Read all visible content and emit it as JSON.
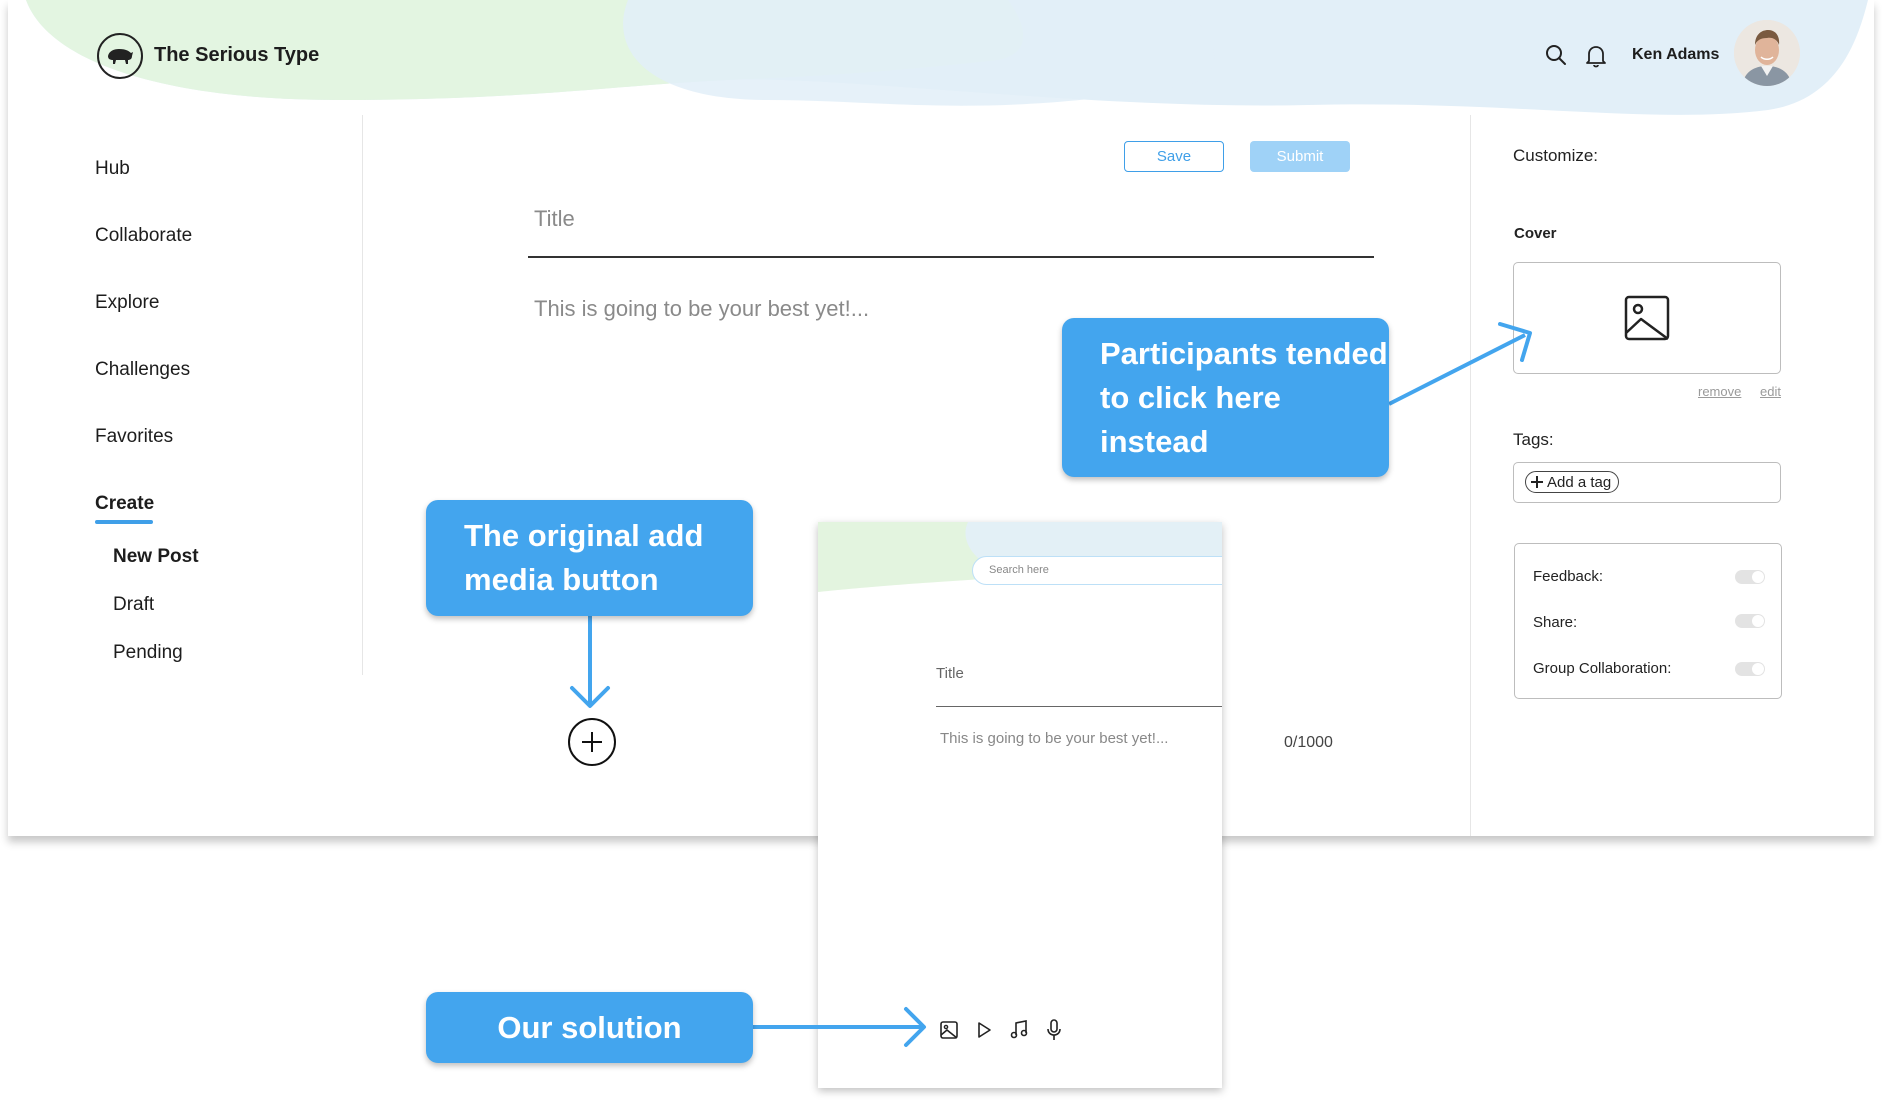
{
  "header": {
    "brand": "The Serious Type",
    "user_name": "Ken Adams",
    "icons": [
      "search-icon",
      "bell-icon"
    ]
  },
  "sidebar": {
    "items": [
      "Hub",
      "Collaborate",
      "Explore",
      "Challenges",
      "Favorites",
      "Create"
    ],
    "active": "Create",
    "subitems": [
      "New Post",
      "Draft",
      "Pending"
    ]
  },
  "editor": {
    "save_label": "Save",
    "submit_label": "Submit",
    "title_placeholder": "Title",
    "body_placeholder": "This is going to be your best yet!...",
    "counter": "0/1000"
  },
  "customize": {
    "heading": "Customize:",
    "cover_label": "Cover",
    "remove_label": "remove",
    "edit_label": "edit",
    "tags_label": "Tags:",
    "add_tag_label": "Add a tag",
    "settings": [
      {
        "label": "Feedback:",
        "enabled": false
      },
      {
        "label": "Share:",
        "enabled": false
      },
      {
        "label": "Group Collaboration:",
        "enabled": false
      }
    ]
  },
  "mobile_mockup": {
    "search_placeholder": "Search here",
    "title_placeholder": "Title",
    "body_placeholder": "This is going to be your best yet!...",
    "media_icons": [
      "image-icon",
      "play-icon",
      "music-icon",
      "microphone-icon"
    ]
  },
  "callouts": {
    "cover_callout": "Participants tended to click here instead",
    "original_callout": "The original add media button",
    "solution_callout": "Our solution"
  },
  "colors": {
    "accent": "#3f9fe8",
    "callout": "#43a5ee",
    "submit_disabled": "#9fd2f7",
    "blob_green": "#e3f4df",
    "blob_blue": "#e2eff8"
  }
}
